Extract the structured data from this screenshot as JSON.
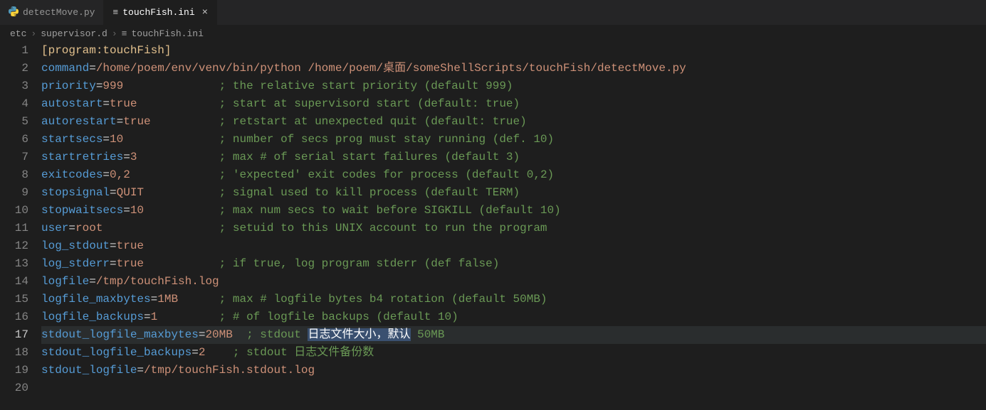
{
  "tabs": {
    "inactive": {
      "icon": "⚙",
      "label": "detectMove.py"
    },
    "active": {
      "icon": "≡",
      "label": "touchFish.ini",
      "close": "×"
    }
  },
  "breadcrumbs": {
    "p0": "etc",
    "p1": "supervisor.d",
    "p2_icon": "≡",
    "p2": "touchFish.ini",
    "sep": "›"
  },
  "lines": {
    "l1": {
      "section": "[program:touchFish]"
    },
    "l2": {
      "key": "command",
      "eq": "=",
      "val": "/home/poem/env/venv/bin/python /home/poem/桌面/someShellScripts/touchFish/detectMove.py"
    },
    "l3": {
      "key": "priority",
      "eq": "=",
      "val": "999",
      "pad": "              ",
      "cmt": "; the relative start priority (default 999)"
    },
    "l4": {
      "key": "autostart",
      "eq": "=",
      "val": "true",
      "pad": "            ",
      "cmt": "; start at supervisord start (default: true)"
    },
    "l5": {
      "key": "autorestart",
      "eq": "=",
      "val": "true",
      "pad": "          ",
      "cmt": "; retstart at unexpected quit (default: true)"
    },
    "l6": {
      "key": "startsecs",
      "eq": "=",
      "val": "10",
      "pad": "              ",
      "cmt": "; number of secs prog must stay running (def. 10)"
    },
    "l7": {
      "key": "startretries",
      "eq": "=",
      "val": "3",
      "pad": "            ",
      "cmt": "; max # of serial start failures (default 3)"
    },
    "l8": {
      "key": "exitcodes",
      "eq": "=",
      "val": "0,2",
      "pad": "             ",
      "cmt": "; 'expected' exit codes for process (default 0,2)"
    },
    "l9": {
      "key": "stopsignal",
      "eq": "=",
      "val": "QUIT",
      "pad": "           ",
      "cmt": "; signal used to kill process (default TERM)"
    },
    "l10": {
      "key": "stopwaitsecs",
      "eq": "=",
      "val": "10",
      "pad": "           ",
      "cmt": "; max num secs to wait before SIGKILL (default 10)"
    },
    "l11": {
      "key": "user",
      "eq": "=",
      "val": "root",
      "pad": "                 ",
      "cmt": "; setuid to this UNIX account to run the program"
    },
    "l12": {
      "key": "log_stdout",
      "eq": "=",
      "val": "true"
    },
    "l13": {
      "key": "log_stderr",
      "eq": "=",
      "val": "true",
      "pad": "           ",
      "cmt": "; if true, log program stderr (def false)"
    },
    "l14": {
      "key": "logfile",
      "eq": "=",
      "val": "/tmp/touchFish.log"
    },
    "l15": {
      "key": "logfile_maxbytes",
      "eq": "=",
      "val": "1MB",
      "pad": "      ",
      "cmt": "; max # logfile bytes b4 rotation (default 50MB)"
    },
    "l16": {
      "key": "logfile_backups",
      "eq": "=",
      "val": "1",
      "pad": "         ",
      "cmt": "; # of logfile backups (default 10)"
    },
    "l17": {
      "key": "stdout_logfile_maxbytes",
      "eq": "=",
      "val": "20MB",
      "pad": "  ",
      "cmt_pre": "; stdout ",
      "cmt_sel": "日志文件大小，默认",
      "cmt_post": " 50MB"
    },
    "l18": {
      "key": "stdout_logfile_backups",
      "eq": "=",
      "val": "2",
      "pad": "    ",
      "cmt": "; stdout 日志文件备份数"
    },
    "l19": {
      "key": "stdout_logfile",
      "eq": "=",
      "val": "/tmp/touchFish.stdout.log"
    }
  },
  "line_numbers": {
    "n1": "1",
    "n2": "2",
    "n3": "3",
    "n4": "4",
    "n5": "5",
    "n6": "6",
    "n7": "7",
    "n8": "8",
    "n9": "9",
    "n10": "10",
    "n11": "11",
    "n12": "12",
    "n13": "13",
    "n14": "14",
    "n15": "15",
    "n16": "16",
    "n17": "17",
    "n18": "18",
    "n19": "19",
    "n20": "20"
  }
}
